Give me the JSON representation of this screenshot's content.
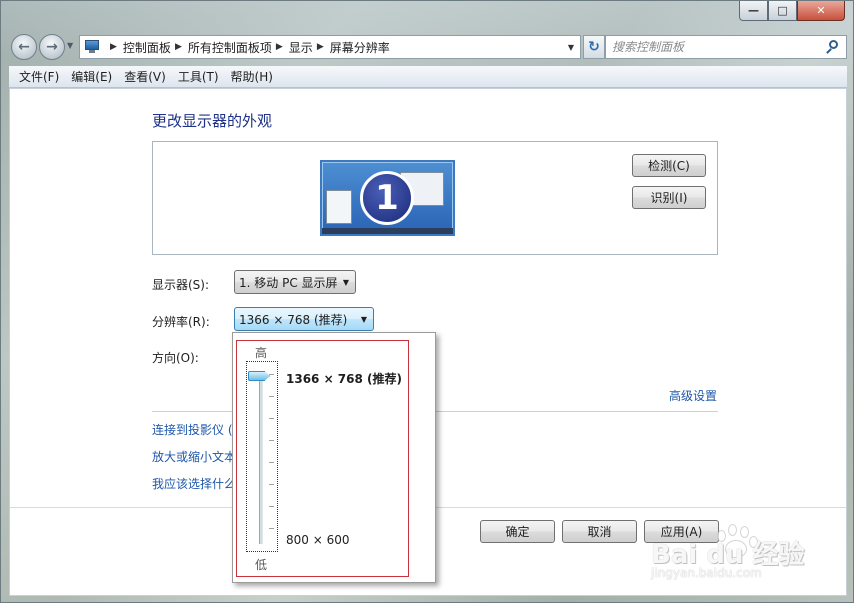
{
  "window": {
    "caption": {
      "minimize": "—",
      "maximize": "□",
      "close": "✕"
    }
  },
  "nav": {
    "back": "←",
    "forward": "→",
    "breadcrumbs": [
      "控制面板",
      "所有控制面板项",
      "显示",
      "屏幕分辨率"
    ],
    "search_placeholder": "搜索控制面板"
  },
  "menu": [
    "文件(F)",
    "编辑(E)",
    "查看(V)",
    "工具(T)",
    "帮助(H)"
  ],
  "page": {
    "heading": "更改显示器的外观",
    "monitor_number": "1",
    "detect_label": "检测(C)",
    "identify_label": "识别(I)",
    "display_label": "显示器(S):",
    "display_value": "1. 移动 PC 显示屏",
    "resolution_label": "分辨率(R):",
    "resolution_value": "1366 × 768 (推荐)",
    "orientation_label": "方向(O):",
    "advanced_link": "高级设置",
    "links": [
      "连接到投影仪 (",
      "放大或缩小文本",
      "我应该选择什么"
    ],
    "ok_label": "确定",
    "cancel_label": "取消",
    "apply_label": "应用(A)"
  },
  "resolution_popup": {
    "high_label": "高",
    "low_label": "低",
    "max_resolution": "1366 × 768 (推荐)",
    "min_resolution": "800 × 600",
    "slider_level": 1.0
  },
  "watermark": {
    "text": "Bai du 经验",
    "sub": "jingyan.baidu.com"
  },
  "colors": {
    "link": "#1e57a8",
    "heading": "#1e3287",
    "popup_frame": "#c8323a",
    "combo_focus": "#3c7fb1"
  }
}
